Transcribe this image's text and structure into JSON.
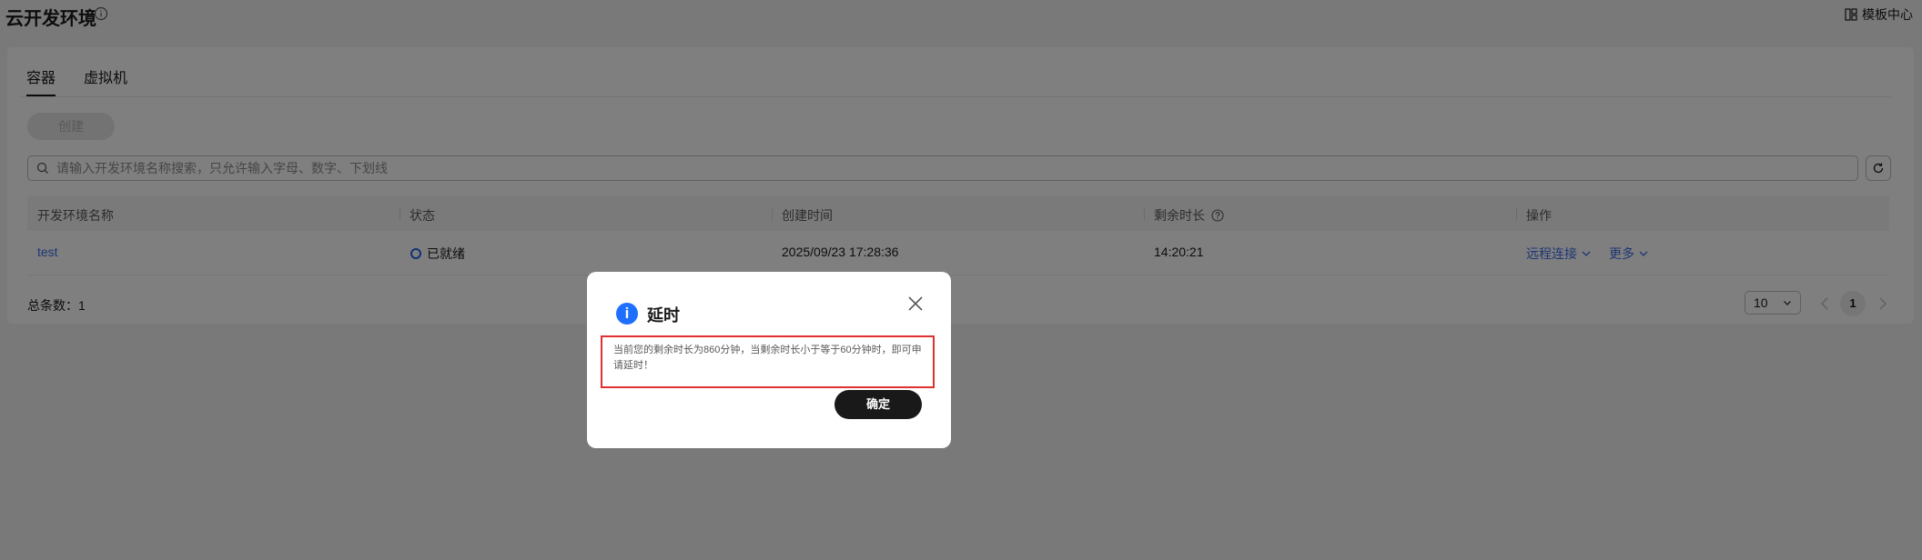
{
  "header": {
    "title": "云开发环境",
    "template_center_label": "模板中心"
  },
  "tabs": [
    {
      "label": "容器",
      "active": true
    },
    {
      "label": "虚拟机",
      "active": false
    }
  ],
  "toolbar": {
    "create_label": "创建"
  },
  "search": {
    "placeholder": "请输入开发环境名称搜索，只允许输入字母、数字、下划线"
  },
  "table": {
    "columns": [
      "开发环境名称",
      "状态",
      "创建时间",
      "剩余时长",
      "操作"
    ],
    "rows": [
      {
        "name": "test",
        "status": "已就绪",
        "created": "2025/09/23 17:28:36",
        "remaining": "14:20:21",
        "action_remote": "远程连接",
        "action_more": "更多"
      }
    ]
  },
  "pagination": {
    "total_label": "总条数：1",
    "page_size": "10",
    "current_page": "1"
  },
  "modal": {
    "icon_text": "i",
    "title": "延时",
    "message": "当前您的剩余时长为860分钟，当剩余时长小于等于60分钟时，即可申请延时！",
    "ok_label": "确定"
  },
  "colors": {
    "accent_link": "#3b6ee8",
    "info_blue": "#1f6fff",
    "highlight_red": "#e03131",
    "primary_button": "#191919"
  }
}
